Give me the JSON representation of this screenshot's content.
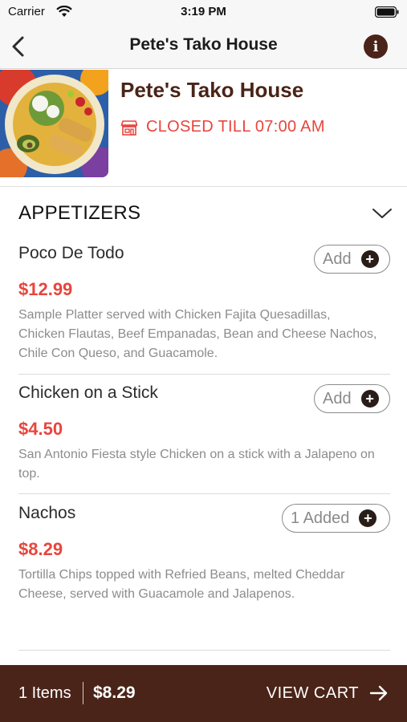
{
  "status_bar": {
    "carrier": "Carrier",
    "time": "3:19 PM"
  },
  "nav": {
    "title": "Pete's Tako House"
  },
  "restaurant": {
    "name": "Pete's Tako House",
    "status": "CLOSED TILL 07:00 AM",
    "status_color": "#e8453c"
  },
  "section": {
    "title": "APPETIZERS"
  },
  "items": [
    {
      "name": "Poco De Todo",
      "price": "$12.99",
      "description": "Sample Platter served with Chicken Fajita Quesadillas, Chicken Flautas, Beef Empanadas, Bean and Cheese Nachos, Chile Con Queso, and Guacamole.",
      "button_label": "Add"
    },
    {
      "name": "Chicken on a Stick",
      "price": "$4.50",
      "description": "San Antonio Fiesta style Chicken on a stick with a Jalapeno on top.",
      "button_label": "Add"
    },
    {
      "name": "Nachos",
      "price": "$8.29",
      "description": "Tortilla Chips topped with Refried Beans, melted Cheddar Cheese, served with Guacamole and Jalapenos.",
      "button_label": "1 Added"
    }
  ],
  "cart": {
    "count": "1 Items",
    "total": "$8.29",
    "view_label": "VIEW CART"
  },
  "colors": {
    "brand": "#4a2418",
    "price": "#e8453c"
  },
  "icons": {
    "back": "chevron-left-icon",
    "info": "info-icon",
    "store": "store-icon",
    "collapse": "chevron-down-icon",
    "add": "plus-icon",
    "cart_arrow": "arrow-right-icon"
  }
}
